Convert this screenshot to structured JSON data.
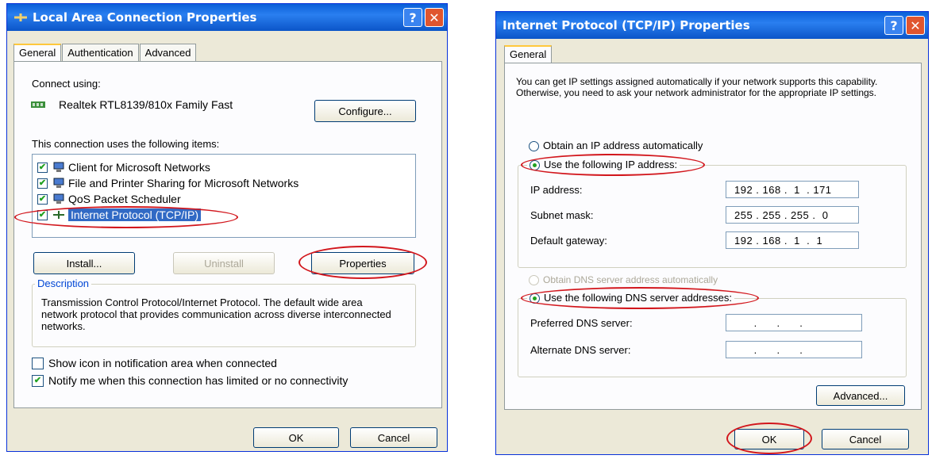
{
  "left": {
    "title": "Local Area Connection Properties",
    "tabs": [
      "General",
      "Authentication",
      "Advanced"
    ],
    "connect_using_label": "Connect using:",
    "adapter_name": "Realtek RTL8139/810x Family Fast",
    "configure_label": "Configure...",
    "items_label": "This connection uses the following items:",
    "items": [
      {
        "label": "Client for Microsoft Networks",
        "checked": true
      },
      {
        "label": "File and Printer Sharing for Microsoft Networks",
        "checked": true
      },
      {
        "label": "QoS Packet Scheduler",
        "checked": true
      },
      {
        "label": "Internet Protocol (TCP/IP)",
        "checked": true,
        "selected": true
      }
    ],
    "install_label": "Install...",
    "uninstall_label": "Uninstall",
    "properties_label": "Properties",
    "description_title": "Description",
    "description_text": "Transmission Control Protocol/Internet Protocol. The default wide area network protocol that provides communication across diverse interconnected networks.",
    "show_icon_label": "Show icon in notification area when connected",
    "notify_label": "Notify me when this connection has limited or no connectivity",
    "ok_label": "OK",
    "cancel_label": "Cancel"
  },
  "right": {
    "title": "Internet Protocol (TCP/IP) Properties",
    "tab": "General",
    "intro": "You can get IP settings assigned automatically if your network supports this capability. Otherwise, you need to ask your network administrator for the appropriate IP settings.",
    "obtain_ip_label": "Obtain an IP address automatically",
    "use_ip_label": "Use the following IP address:",
    "ip_address_label": "IP address:",
    "ip_address_value": "192 . 168 .  1  . 171",
    "subnet_label": "Subnet mask:",
    "subnet_value": "255 . 255 . 255 .  0",
    "gateway_label": "Default gateway:",
    "gateway_value": "192 . 168 .  1  .  1",
    "obtain_dns_label": "Obtain DNS server address automatically",
    "use_dns_label": "Use the following DNS server addresses:",
    "preferred_dns_label": "Preferred DNS server:",
    "preferred_dns_value": "      .      .      .",
    "alternate_dns_label": "Alternate DNS server:",
    "alternate_dns_value": "      .      .      .",
    "advanced_label": "Advanced...",
    "ok_label": "OK",
    "cancel_label": "Cancel"
  },
  "colors": {
    "title_bar": "#0a5fd8",
    "annotation_red": "#d2161c",
    "selection": "#316ac5"
  }
}
